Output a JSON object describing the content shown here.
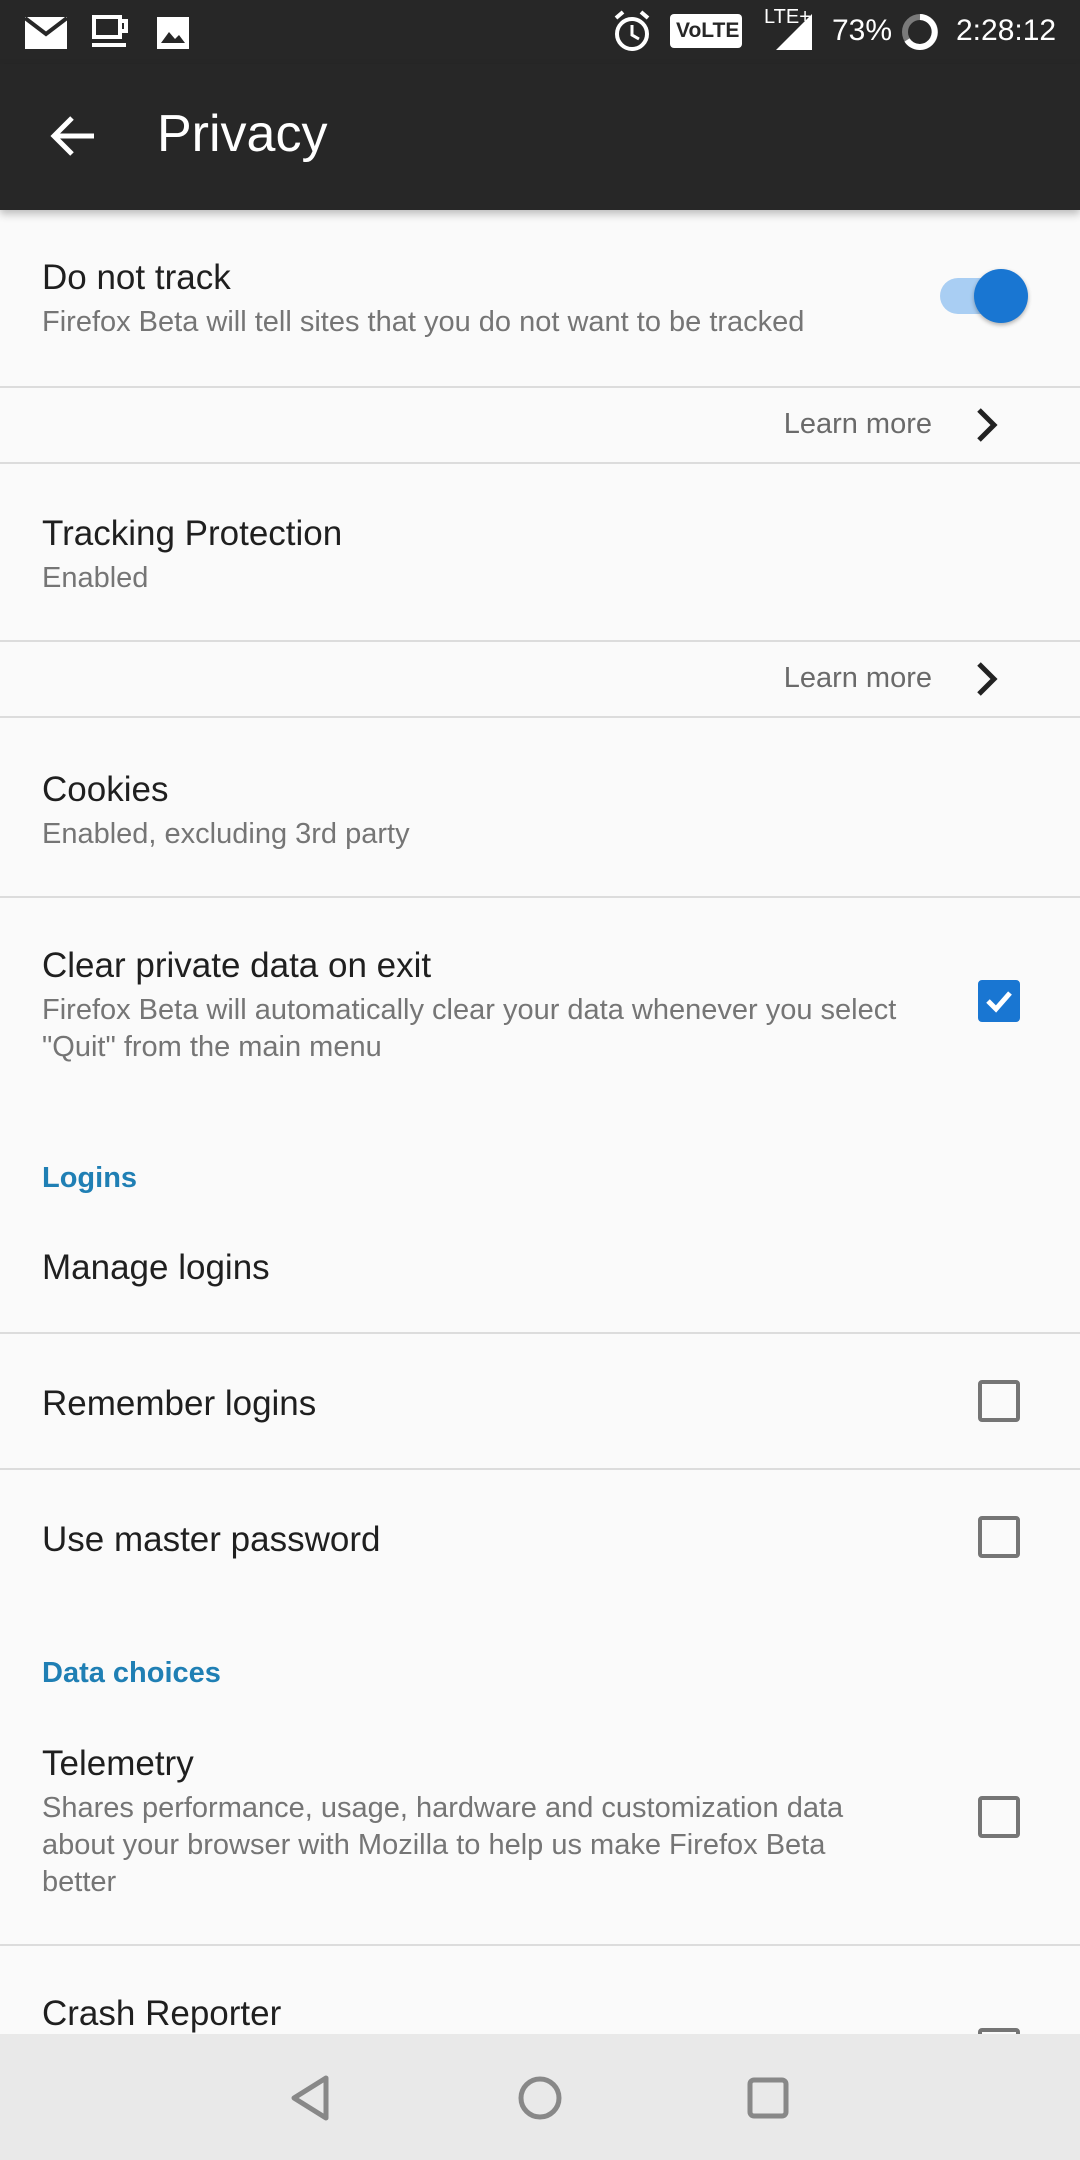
{
  "status_bar": {
    "battery": "73%",
    "time": "2:28:12",
    "network": "LTE+",
    "volte": "VoLTE",
    "icons_left": [
      "mail-icon",
      "cup-icon",
      "image-icon"
    ],
    "icons_right": [
      "alarm-icon",
      "volte-icon",
      "signal-icon",
      "battery-icon"
    ]
  },
  "app_bar": {
    "title": "Privacy",
    "back_icon": "arrow-back-icon"
  },
  "settings": {
    "do_not_track": {
      "label": "Do not track",
      "summary": "Firefox Beta will tell sites that you do not want to be tracked",
      "enabled": true
    },
    "learn_more_1": "Learn more",
    "tracking_protection": {
      "label": "Tracking Protection",
      "summary": "Enabled"
    },
    "learn_more_2": "Learn more",
    "cookies": {
      "label": "Cookies",
      "summary": "Enabled, excluding 3rd party"
    },
    "clear_private_data": {
      "label": "Clear private data on exit",
      "summary": "Firefox Beta will automatically clear your data whenever you select \"Quit\" from the main menu",
      "checked": true
    },
    "logins_section": "Logins",
    "manage_logins": {
      "label": "Manage logins"
    },
    "remember_logins": {
      "label": "Remember logins",
      "checked": false
    },
    "master_password": {
      "label": "Use master password",
      "checked": false
    },
    "data_choices_section": "Data choices",
    "telemetry": {
      "label": "Telemetry",
      "summary": "Shares performance, usage, hardware and customization data about your browser with Mozilla to help us make Firefox Beta better",
      "checked": false
    },
    "crash_reporter": {
      "label": "Crash Reporter",
      "checked": false
    }
  },
  "nav_bar": {
    "back": "nav-back-icon",
    "home": "nav-home-icon",
    "recents": "nav-recents-icon"
  },
  "colors": {
    "accent": "#1976d2",
    "section": "#1f7fb4",
    "bar": "#272727"
  }
}
